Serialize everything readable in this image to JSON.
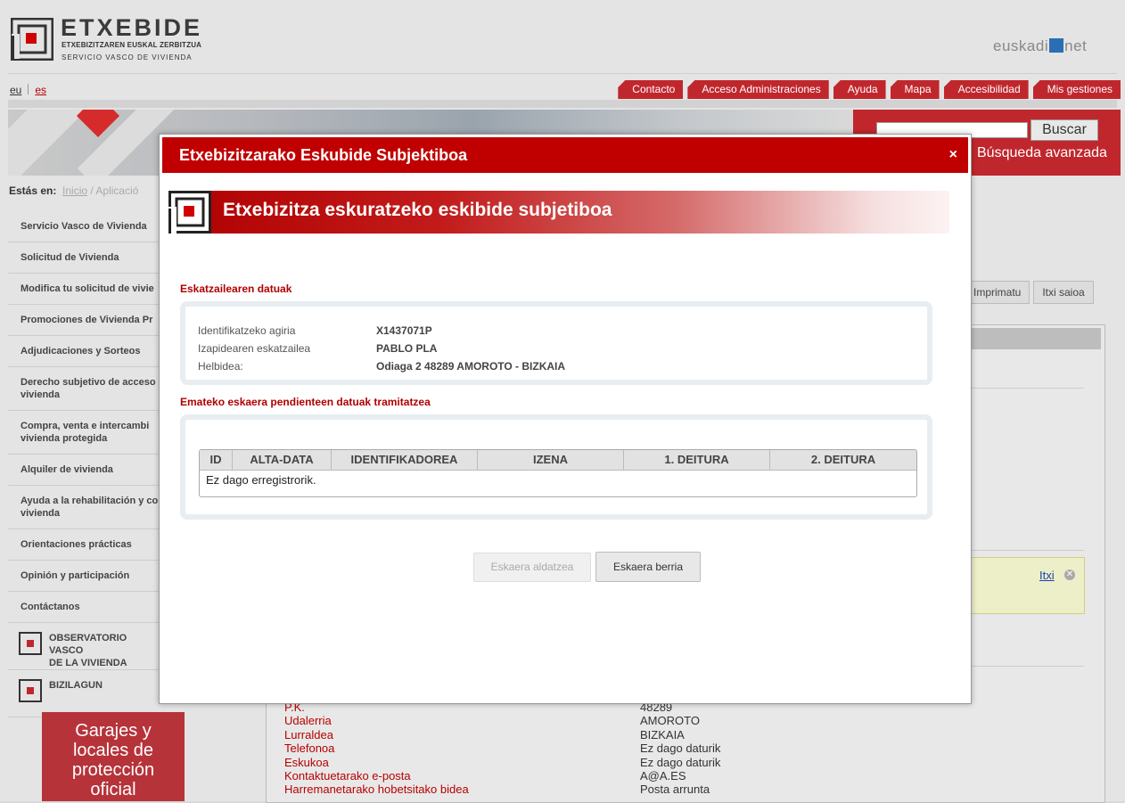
{
  "header": {
    "logo_title": "ETXEBIDE",
    "logo_sub1": "ETXEBIZITZAREN EUSKAL ZERBITZUA",
    "logo_sub2": "SERVICIO VASCO DE VIVIENDA",
    "portal_left": "euskadi",
    "portal_right": "net"
  },
  "lang": {
    "eu": "eu",
    "es": "es"
  },
  "topnav": [
    "Contacto",
    "Acceso Administraciones",
    "Ayuda",
    "Mapa",
    "Accesibilidad",
    "Mis gestiones"
  ],
  "search": {
    "button": "Buscar",
    "advanced": "Búsqueda avanzada"
  },
  "breadcrumb": {
    "label": "Estás en:",
    "home": "Inicio",
    "current": "Aplicació"
  },
  "sidenav": [
    "Servicio Vasco de Vivienda",
    "Solicitud de Vivienda",
    "Modifica tu solicitud de vivie",
    "Promociones de Vivienda Pr",
    "Adjudicaciones y Sorteos",
    "Derecho subjetivo de acceso",
    "vivienda",
    "Compra, venta e intercambi",
    "vivienda protegida",
    "Alquiler de vivienda",
    "Ayuda a la rehabilitación y co",
    "vivienda",
    "Orientaciones prácticas",
    "Opinión y participación",
    "Contáctanos"
  ],
  "side_boxes": {
    "observatorio_1": "OBSERVATORIO VASCO",
    "observatorio_2": "DE LA VIVIENDA",
    "bizilagun": "BIZILAGUN"
  },
  "garajes": {
    "l1": "Garajes y",
    "l2": "locales de",
    "l3": "protección",
    "l4": "oficial"
  },
  "print_buttons": {
    "print": "Imprimatu",
    "logout": "Itxi saioa"
  },
  "note": {
    "close": "Itxi"
  },
  "bottom_rows": [
    {
      "k": "P.K.",
      "v": "48289"
    },
    {
      "k": "Udalerria",
      "v": "AMOROTO"
    },
    {
      "k": "Lurraldea",
      "v": "BIZKAIA"
    },
    {
      "k": "Telefonoa",
      "v": "Ez dago daturik"
    },
    {
      "k": "Eskukoa",
      "v": "Ez dago daturik"
    },
    {
      "k": "Kontaktuetarako e-posta",
      "v": "A@A.ES"
    },
    {
      "k": "Harremanetarako hobetsitako bidea",
      "v": "Posta arrunta"
    }
  ],
  "modal": {
    "header": "Etxebizitzarako Eskubide Subjektiboa",
    "close": "×",
    "title": "Etxebizitza eskuratzeko eskibide subjetiboa",
    "section1": "Eskatzailearen datuak",
    "fields": [
      {
        "label": "Identifikatzeko agiria",
        "value": "X1437071P"
      },
      {
        "label": "Izapidearen eskatzailea",
        "value": "PABLO PLA"
      },
      {
        "label": "Helbidea:",
        "value": "Odiaga 2 48289 AMOROTO - BIZKAIA"
      }
    ],
    "section2": "Emateko eskaera pendienteen datuak tramitatzea",
    "table_headers": [
      "ID",
      "ALTA-DATA",
      "IDENTIFIKADOREA",
      "IZENA",
      "1. DEITURA",
      "2. DEITURA"
    ],
    "table_empty": "Ez dago erregistrorik.",
    "btn_modify": "Eskaera aldatzea",
    "btn_new": "Eskaera berria"
  },
  "colors": {
    "brand_red": "#c00000",
    "link_red": "#b80000",
    "nav_red": "#c0272d"
  }
}
